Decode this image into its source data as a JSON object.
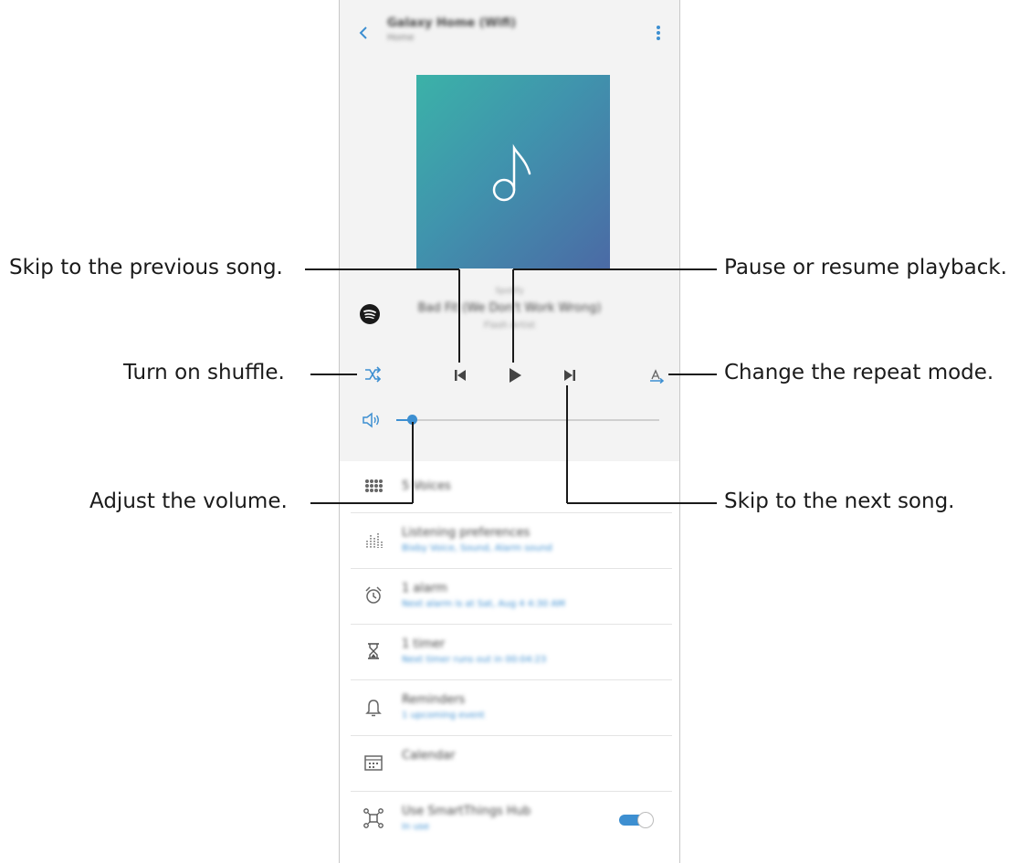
{
  "callouts": {
    "previous": "Skip to the previous song.",
    "pause": "Pause or resume playback.",
    "shuffle": "Turn on shuffle.",
    "repeat": "Change the repeat mode.",
    "volume": "Adjust the volume.",
    "next": "Skip to the next song."
  },
  "player": {
    "title": "Galaxy Home (Wifi)",
    "subtitle": "Home",
    "track_meta": "Spotify",
    "track_title": "Bad Fit (We Don't Work Wrong)",
    "track_artist": "Flash Artist",
    "volume_level": 0.06
  },
  "list": [
    {
      "primary": "5 Voices",
      "secondary": "",
      "icon": "grid-icon"
    },
    {
      "primary": "Listening preferences",
      "secondary": "Bixby Voice, Sound, Alarm sound",
      "icon": "equalizer-icon"
    },
    {
      "primary": "1 alarm",
      "secondary": "Next alarm is at Sat, Aug 4 4:30 AM",
      "icon": "alarm-clock-icon"
    },
    {
      "primary": "1 timer",
      "secondary": "Next timer runs out in 00:04:23",
      "icon": "hourglass-icon"
    },
    {
      "primary": "Reminders",
      "secondary": "1 upcoming event",
      "icon": "bell-icon"
    },
    {
      "primary": "Calendar",
      "secondary": "",
      "icon": "calendar-icon"
    },
    {
      "primary": "Use SmartThings Hub",
      "secondary": "In use",
      "icon": "smartthings-hub-icon",
      "toggle": true
    }
  ],
  "colors": {
    "accent": "#3d8fd1",
    "album_start": "#3bb2a8",
    "album_end": "#4b6aa5"
  }
}
